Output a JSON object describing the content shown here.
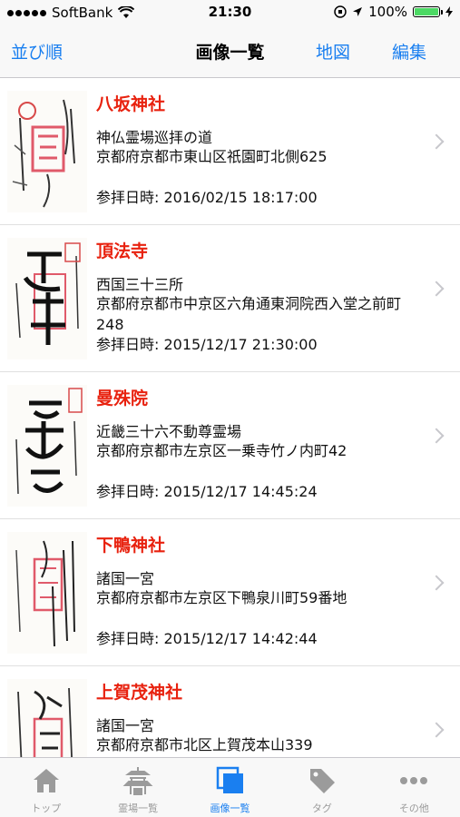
{
  "status_bar": {
    "carrier": "SoftBank",
    "time": "21:30",
    "battery": "100%"
  },
  "nav": {
    "left_button": "並び順",
    "title": "画像一覧",
    "map_button": "地図",
    "edit_button": "編集"
  },
  "items": [
    {
      "name": "八坂神社",
      "category": "神仏霊場巡拝の道",
      "address": "京都府京都市東山区祇園町北側625",
      "date": "参拝日時: 2016/02/15 18:17:00"
    },
    {
      "name": "頂法寺",
      "category": "西国三十三所",
      "address": "京都府京都市中京区六角通東洞院西入堂之前町248",
      "date": "参拝日時: 2015/12/17 21:30:00"
    },
    {
      "name": "曼殊院",
      "category": "近畿三十六不動尊霊場",
      "address": "京都府京都市左京区一乗寺竹ノ内町42",
      "date": "参拝日時: 2015/12/17 14:45:24"
    },
    {
      "name": "下鴨神社",
      "category": "諸国一宮",
      "address": "京都府京都市左京区下鴨泉川町59番地",
      "date": "参拝日時: 2015/12/17 14:42:44"
    },
    {
      "name": "上賀茂神社",
      "category": "諸国一宮",
      "address": "京都府京都市北区上賀茂本山339",
      "date": ""
    }
  ],
  "tabs": [
    {
      "label": "トップ",
      "icon": "house-icon"
    },
    {
      "label": "霊場一覧",
      "icon": "temple-icon"
    },
    {
      "label": "画像一覧",
      "icon": "images-icon",
      "active": true
    },
    {
      "label": "タグ",
      "icon": "tag-icon"
    },
    {
      "label": "その他",
      "icon": "more-icon"
    }
  ],
  "colors": {
    "accent": "#1a7ff0",
    "title_red": "#e8220f"
  }
}
